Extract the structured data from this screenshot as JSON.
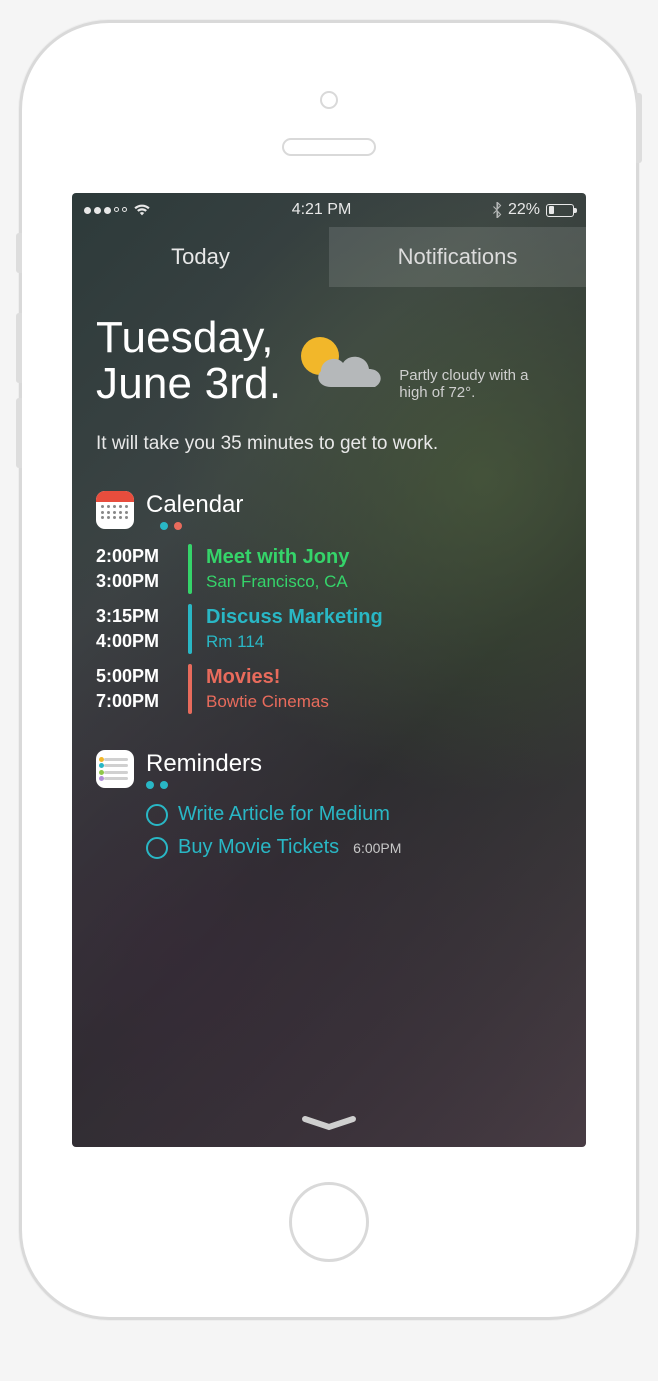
{
  "status": {
    "signal_filled": 3,
    "signal_total": 5,
    "time": "4:21 PM",
    "battery_text": "22%",
    "battery_pct": 22
  },
  "tabs": {
    "active": "Today",
    "inactive": "Notifications"
  },
  "date": {
    "line1": "Tuesday,",
    "line2": "June 3rd."
  },
  "weather": {
    "summary": "Partly cloudy with a high of 72°."
  },
  "travel": "It will take you 35 minutes to get to work.",
  "calendar": {
    "title": "Calendar",
    "dot_colors": [
      "#35d46a",
      "#29b7c5",
      "#e86b5c"
    ],
    "events": [
      {
        "start": "2:00PM",
        "end": "3:00PM",
        "title": "Meet with Jony",
        "sub": "San Francisco, CA",
        "color": "#35d46a"
      },
      {
        "start": "3:15PM",
        "end": "4:00PM",
        "title": "Discuss Marketing",
        "sub": "Rm 114",
        "color": "#29b7c5"
      },
      {
        "start": "5:00PM",
        "end": "7:00PM",
        "title": "Movies!",
        "sub": "Bowtie Cinemas",
        "color": "#e86b5c"
      }
    ]
  },
  "reminders": {
    "title": "Reminders",
    "dot_colors": [
      "#29b7c5",
      "#29b7c5"
    ],
    "items": [
      {
        "title": "Write Article for Medium",
        "time": ""
      },
      {
        "title": "Buy Movie Tickets",
        "time": "6:00PM"
      }
    ]
  }
}
